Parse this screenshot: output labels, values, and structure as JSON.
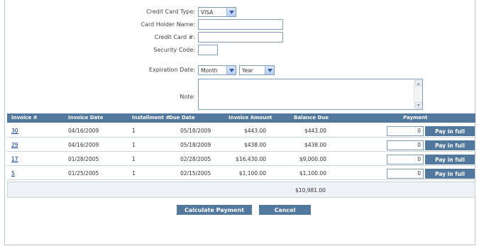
{
  "form": {
    "card_type_label": "Credit Card Type:",
    "card_type_value": "VISA",
    "holder_label": "Card Holder Name:",
    "holder_value": "",
    "card_number_label": "Credit Card #:",
    "card_number_value": "",
    "security_label": "Security Code:",
    "security_value": "",
    "expiration_label": "Expiration Date:",
    "month_value": "Month",
    "year_value": "Year",
    "note_label": "Note:",
    "note_value": ""
  },
  "table": {
    "headers": {
      "invoice": "Invoice #",
      "invoice_date": "Invoice Date",
      "installment": "Installment #",
      "due_date": "Due Date",
      "invoice_amount": "Invoice Amount",
      "balance_due": "Balance Due",
      "payment": "Payment"
    },
    "rows": [
      {
        "invoice": "30",
        "invoice_date": "04/16/2009",
        "installment": "1",
        "due_date": "05/18/2009",
        "invoice_amount": "$443.00",
        "balance_due": "$443.00",
        "payment": "0",
        "pay_label": "Pay in full"
      },
      {
        "invoice": "29",
        "invoice_date": "04/16/2009",
        "installment": "1",
        "due_date": "05/18/2009",
        "invoice_amount": "$438.00",
        "balance_due": "$438.00",
        "payment": "0",
        "pay_label": "Pay in full"
      },
      {
        "invoice": "17",
        "invoice_date": "01/28/2005",
        "installment": "1",
        "due_date": "02/28/2005",
        "invoice_amount": "$16,430.00",
        "balance_due": "$9,000.00",
        "payment": "0",
        "pay_label": "Pay in full"
      },
      {
        "invoice": "5",
        "invoice_date": "01/25/2005",
        "installment": "1",
        "due_date": "02/15/2005",
        "invoice_amount": "$1,100.00",
        "balance_due": "$1,100.00",
        "payment": "0",
        "pay_label": "Pay in full"
      }
    ],
    "total_balance": "$10,981.00"
  },
  "actions": {
    "calculate_label": "Calculate Payment",
    "cancel_label": "Cancel"
  },
  "colors": {
    "header_bg": "#53789e",
    "link": "#003399"
  }
}
